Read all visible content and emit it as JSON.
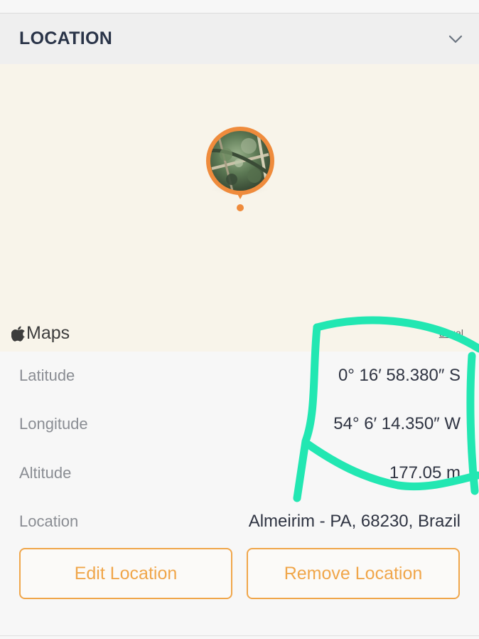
{
  "section": {
    "title": "LOCATION"
  },
  "map": {
    "attribution": "Maps",
    "legal": "Legal"
  },
  "details": [
    {
      "label": "Latitude",
      "value": "0° 16′ 58.380″ S"
    },
    {
      "label": "Longitude",
      "value": "54° 6′ 14.350″ W"
    },
    {
      "label": "Altitude",
      "value": "177.05 m"
    },
    {
      "label": "Location",
      "value": "Almeirim - PA, 68230, Brazil"
    }
  ],
  "actions": {
    "edit_label": "Edit Location",
    "remove_label": "Remove Location"
  },
  "colors": {
    "accent": "#f0a64a",
    "pin": "#ef8b3c",
    "annotation": "#22e7b2",
    "map_bg": "#f8f4ea"
  },
  "icons": {
    "collapse": "chevron-down-icon",
    "apple": "apple-logo-icon",
    "pin": "map-pin-icon"
  }
}
